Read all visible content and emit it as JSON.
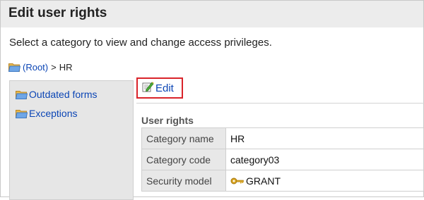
{
  "header": {
    "title": "Edit user rights"
  },
  "description": "Select a category to view and change access privileges.",
  "breadcrumb": {
    "root": "(Root)",
    "separator": ">",
    "current": "HR"
  },
  "tree": {
    "items": [
      {
        "label": "Outdated forms",
        "icon": "folder-icon"
      },
      {
        "label": "Exceptions",
        "icon": "folder-icon"
      }
    ]
  },
  "toolbar": {
    "edit_label": "Edit",
    "edit_icon": "edit-icon"
  },
  "section": {
    "title": "User rights"
  },
  "table": {
    "rows": [
      {
        "key": "Category name",
        "value": "HR"
      },
      {
        "key": "Category code",
        "value": "category03"
      },
      {
        "key": "Security model",
        "value": "GRANT",
        "icon": "key-icon"
      }
    ]
  },
  "colors": {
    "link": "#0b45b5",
    "highlight_border": "#d9232a",
    "key_cell_bg": "#e8e8e8",
    "header_band": "#ececec"
  }
}
